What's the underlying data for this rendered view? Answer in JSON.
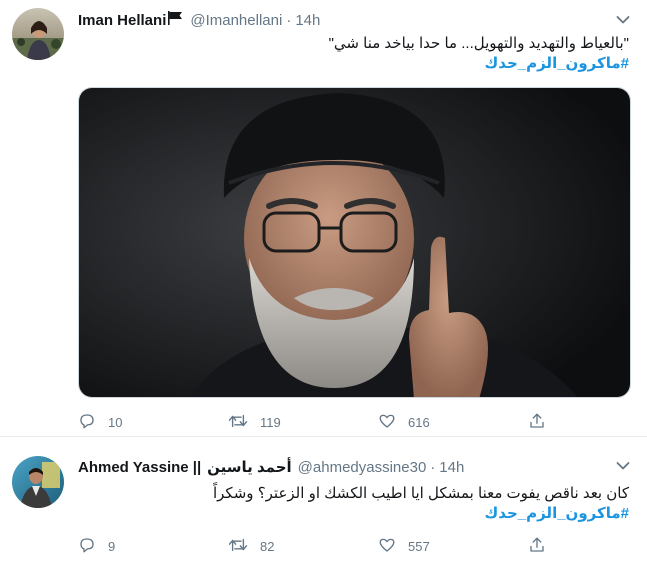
{
  "tweets": [
    {
      "name": "Iman Hellani",
      "handle": "@Imanhellani",
      "dot": "·",
      "time": "14h",
      "text": "\"بالعياط والتهديد والتهويل... ما حدا بياخد منا شي\"",
      "hashtag": "#ماكرون_الزم_حدك",
      "actions": {
        "replies": "10",
        "retweets": "119",
        "likes": "616"
      }
    },
    {
      "name_en": "Ahmed Yassine ||",
      "name_ar": "أحمد ياسين",
      "handle": "@ahmedyassine30",
      "dot": "·",
      "time": "14h",
      "text": "كان بعد ناقص يفوت معنا بمشكل ايا اطيب الكشك او الزعتر؟ وشكراً",
      "hashtag": "#ماكرون_الزم_حدك",
      "actions": {
        "replies": "9",
        "retweets": "82",
        "likes": "557"
      }
    }
  ],
  "colors": {
    "link": "#1b95e0",
    "muted": "#657786",
    "text": "#14171a",
    "border": "#e6ecf0"
  },
  "icons": [
    "reply-icon",
    "retweet-icon",
    "like-icon",
    "share-icon",
    "chevron-down-icon",
    "flag-icon"
  ]
}
